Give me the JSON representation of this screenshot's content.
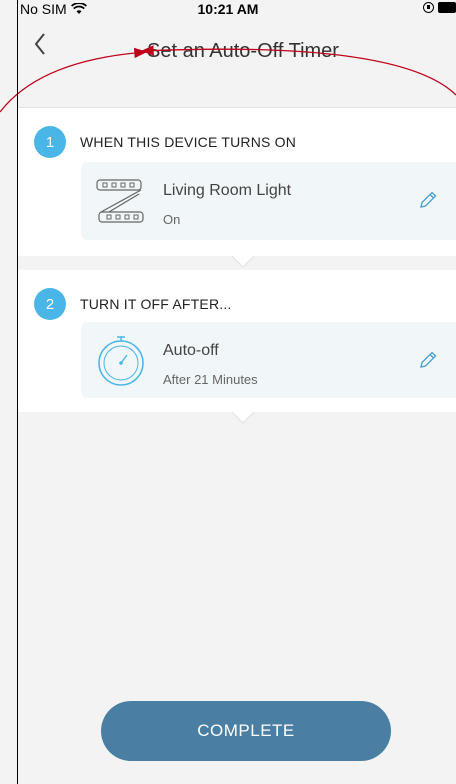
{
  "status_bar": {
    "carrier": "No SIM",
    "time": "10:21 AM"
  },
  "nav": {
    "title": "Set an Auto-Off Timer",
    "back_icon": "chevron-left-icon"
  },
  "steps": [
    {
      "number": "1",
      "label": "WHEN THIS DEVICE TURNS ON",
      "card": {
        "icon": "light-strip-icon",
        "title": "Living Room Light",
        "subtitle": "On",
        "edit_icon": "pencil-icon"
      }
    },
    {
      "number": "2",
      "label": "TURN IT OFF AFTER...",
      "card": {
        "icon": "timer-icon",
        "title": "Auto-off",
        "subtitle": "After 21 Minutes",
        "edit_icon": "pencil-icon"
      }
    }
  ],
  "complete_button": {
    "label": "COMPLETE"
  },
  "colors": {
    "accent": "#4ab6e8",
    "button": "#4a7fa3",
    "annotation_arrow": "#c0001a"
  }
}
